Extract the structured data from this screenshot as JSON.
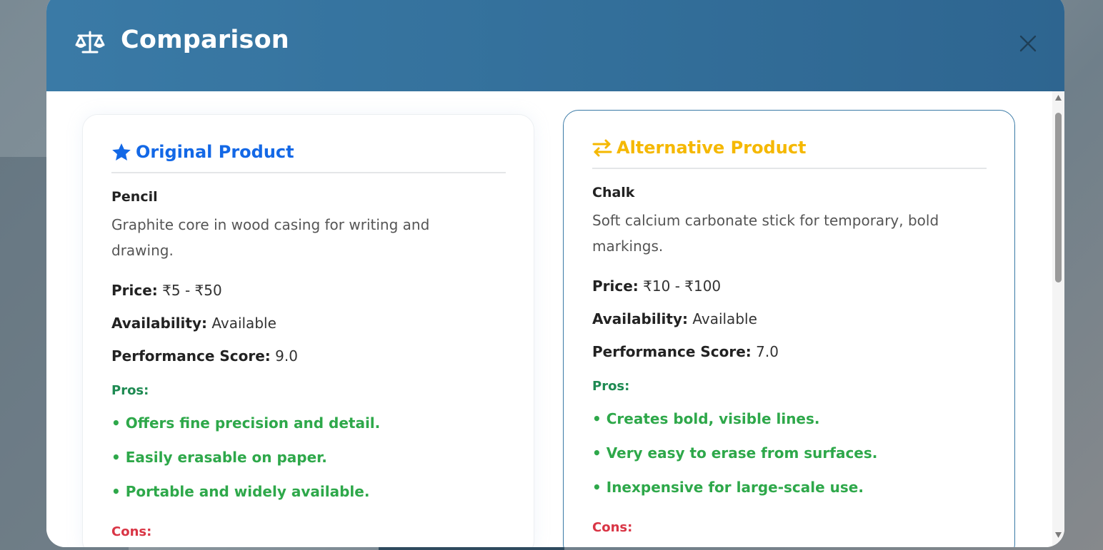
{
  "modal": {
    "title": "Comparison",
    "close_label": "✕"
  },
  "original": {
    "heading": "Original Product",
    "name": "Pencil",
    "description": "Graphite core in wood casing for writing and drawing.",
    "price_label": "Price:",
    "price_value": "₹5 - ₹50",
    "availability_label": "Availability:",
    "availability_value": "Available",
    "performance_label": "Performance Score:",
    "performance_value": "9.0",
    "pros_label": "Pros:",
    "pros": [
      "• Offers fine precision and detail.",
      "• Easily erasable on paper.",
      "• Portable and widely available."
    ],
    "cons_label": "Cons:"
  },
  "alternative": {
    "heading": "Alternative Product",
    "name": "Chalk",
    "description": "Soft calcium carbonate stick for temporary, bold markings.",
    "price_label": "Price:",
    "price_value": "₹10 - ₹100",
    "availability_label": "Availability:",
    "availability_value": "Available",
    "performance_label": "Performance Score:",
    "performance_value": "7.0",
    "pros_label": "Pros:",
    "pros": [
      "• Creates bold, visible lines.",
      "• Very easy to erase from surfaces.",
      "• Inexpensive for large-scale use."
    ],
    "cons_label": "Cons:"
  },
  "colors": {
    "header_gradient_start": "#3a7aa6",
    "original_accent": "#1368e6",
    "alternative_accent": "#f5b800",
    "pros_color": "#2ea84a",
    "cons_color": "#d93545"
  },
  "icons": {
    "header": "balance-scale-icon",
    "original": "star-icon",
    "alternative": "exchange-arrows-icon",
    "close": "close-icon"
  }
}
